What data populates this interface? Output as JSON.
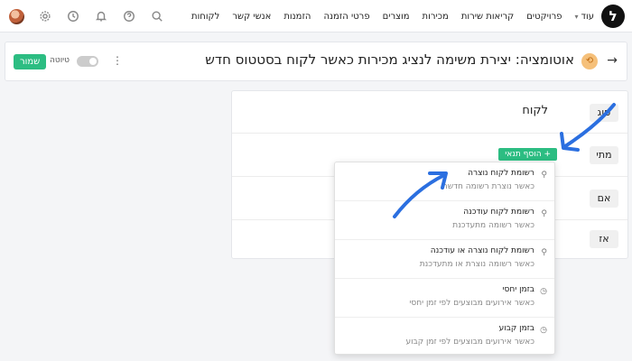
{
  "nav": {
    "logo_glyph": "ל",
    "items": [
      "לקוחות",
      "אנשי קשר",
      "הזמנות",
      "פרטי הזמנה",
      "מוצרים",
      "מכירות",
      "קריאות שירות",
      "פרויקטים"
    ],
    "more_label": "עוד"
  },
  "header": {
    "title": "אוטומציה: יצירת משימה לנציג מכירות כאשר לקוח בסטטוס חדש",
    "save_label": "שמור",
    "draft_label": "טיוטה"
  },
  "rule": {
    "type_label": "סוג",
    "type_value": "לקוח",
    "when_label": "מתי",
    "add_condition_label": "+ הוסף תנאי",
    "if_label": "אם",
    "then_label": "אז"
  },
  "dropdown": {
    "items": [
      {
        "icon": "pin-icon",
        "title": "רשומת לקוח נוצרה",
        "subtitle": "כאשר נוצרת רשומה חדשה"
      },
      {
        "icon": "pin-icon",
        "title": "רשומת לקוח עודכנה",
        "subtitle": "כאשר רשומה מתעדכנת"
      },
      {
        "icon": "pin-icon",
        "title": "רשומת לקוח נוצרה או עודכנה",
        "subtitle": "כאשר רשומה נוצרת או מתעדכנת"
      },
      {
        "icon": "clock-icon",
        "title": "בזמן יחסי",
        "subtitle": "כאשר אירועים מבוצעים לפי זמן יחסי"
      },
      {
        "icon": "clock-icon",
        "title": "בזמן קבוע",
        "subtitle": "כאשר אירועים מבוצעים לפי זמן קבוע"
      }
    ]
  },
  "colors": {
    "accent_green": "#2cbd82",
    "arrow_blue": "#2b6fe0"
  }
}
